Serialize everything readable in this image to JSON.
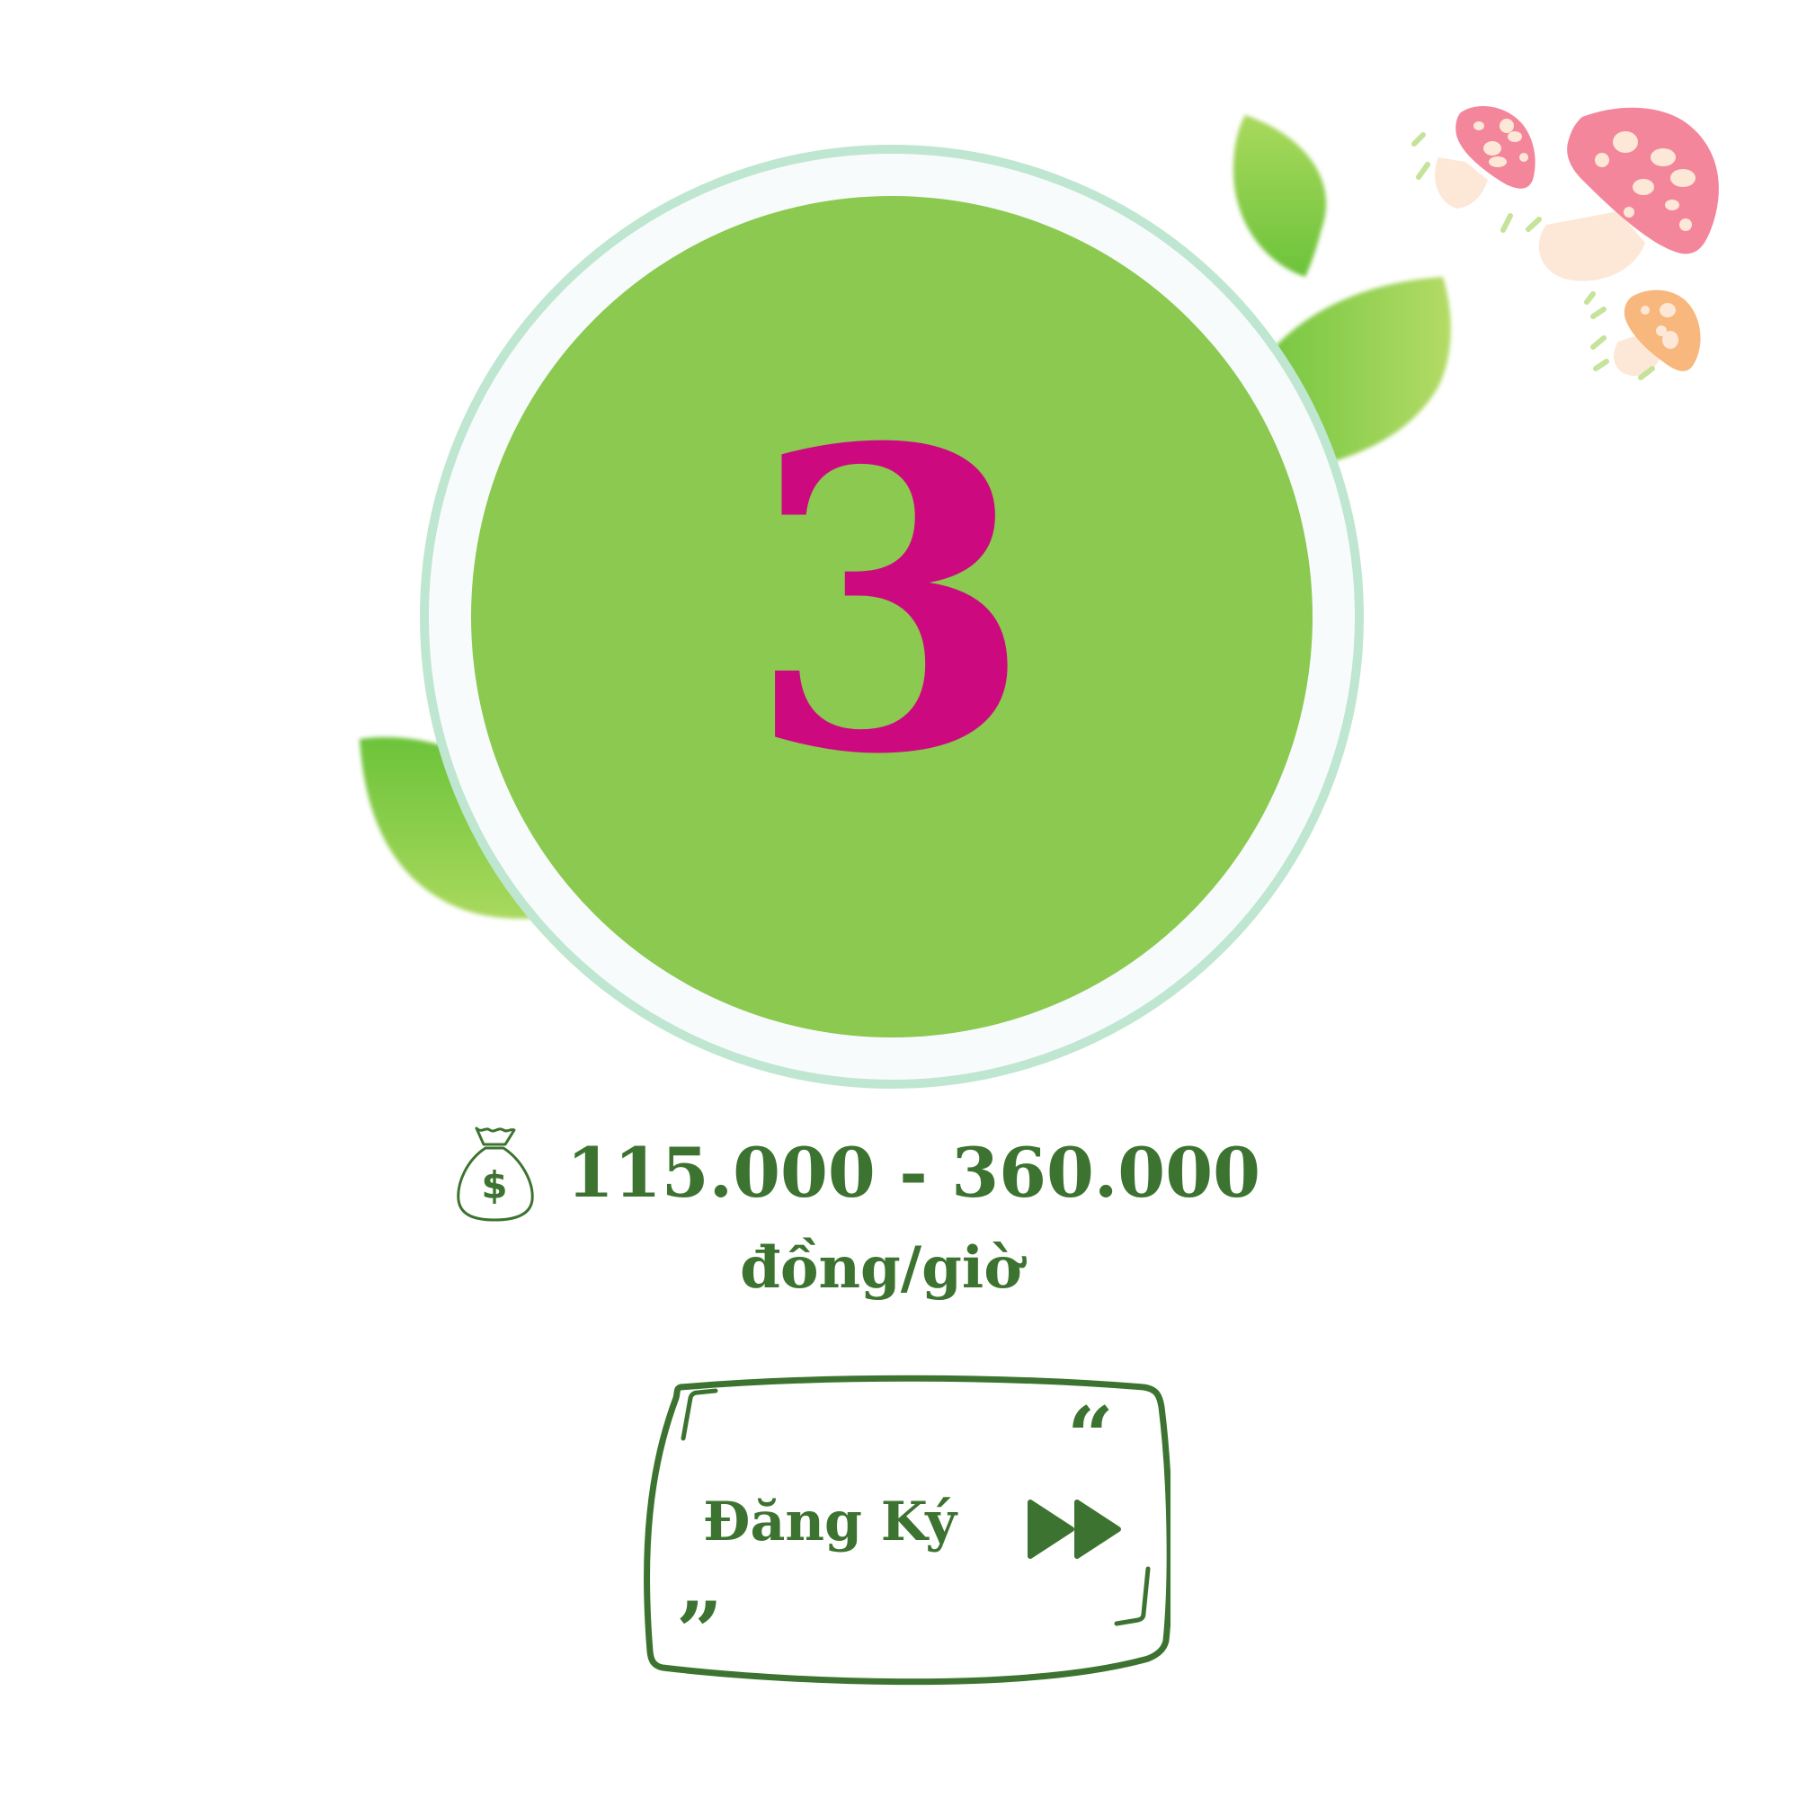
{
  "number": "3",
  "price": {
    "range": "115.000 - 360.000",
    "unit": "đồng/giờ",
    "icon": "money-bag-icon"
  },
  "register_button": {
    "label": "Đăng Ký",
    "open_quote": "“",
    "close_quote": "”",
    "icon": "fast-forward-icon"
  },
  "colors": {
    "circle_fill": "#8bc950",
    "ring": "#bfe6d0",
    "number": "#cd097f",
    "text_green": "#3d7330",
    "leaf_light": "#a9d95d",
    "leaf_dark": "#6cc33a",
    "mushroom_pink": "#f4869b",
    "mushroom_orange": "#f7b77d",
    "mushroom_stem": "#fde8d8"
  }
}
